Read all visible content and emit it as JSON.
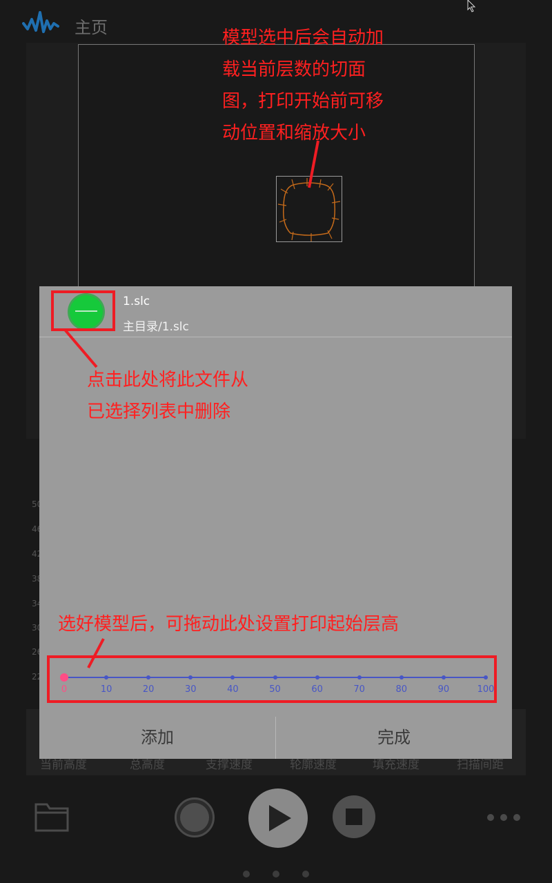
{
  "header": {
    "title": "主页"
  },
  "chart": {
    "y_labels": [
      "50",
      "46",
      "42",
      "38",
      "34",
      "30",
      "26",
      "22"
    ]
  },
  "stats": {
    "labels": [
      "当前高度",
      "总高度",
      "支撑速度",
      "轮廓速度",
      "填充速度",
      "扫描间距"
    ]
  },
  "dialog": {
    "file_name": "1.slc",
    "file_path": "主目录/1.slc",
    "slider": {
      "value": 0,
      "ticks": [
        "0",
        "10",
        "20",
        "30",
        "40",
        "50",
        "60",
        "70",
        "80",
        "90",
        "100"
      ]
    },
    "add_label": "添加",
    "done_label": "完成"
  },
  "annotations": {
    "preview_note": [
      "模型选中后会自动加",
      "载当前层数的切面",
      "图，打印开始前可移",
      "动位置和缩放大小"
    ],
    "remove_note": [
      "点击此处将此文件从",
      "已选择列表中删除"
    ],
    "slider_note": "选好模型后，可拖动此处设置打印起始层高"
  },
  "colors": {
    "accent_pink": "#ff4d85",
    "slider_blue": "#4756c6",
    "remove_green": "#16c93b",
    "annotation_red": "#ff2020",
    "logo_blue": "#1f6fb0"
  },
  "icons": [
    "waveform-logo-icon",
    "cursor-icon",
    "folder-icon",
    "record-icon",
    "play-icon",
    "stop-icon",
    "more-dots-icon",
    "remove-circle-icon"
  ]
}
